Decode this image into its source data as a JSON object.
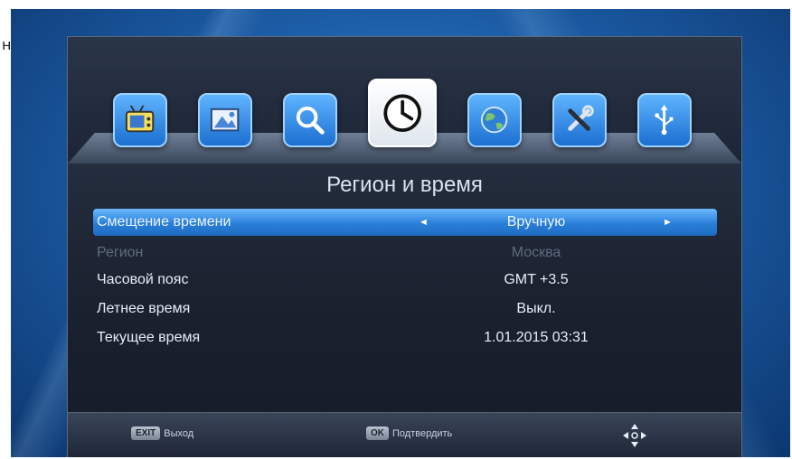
{
  "stray_text": "н",
  "menu": {
    "icons": [
      {
        "name": "tv-icon",
        "active": false
      },
      {
        "name": "picture-icon",
        "active": false
      },
      {
        "name": "search-icon",
        "active": false
      },
      {
        "name": "clock-icon",
        "active": true
      },
      {
        "name": "globe-icon",
        "active": false
      },
      {
        "name": "tools-icon",
        "active": false
      },
      {
        "name": "usb-icon",
        "active": false
      }
    ]
  },
  "page": {
    "title": "Регион и время"
  },
  "settings": {
    "rows": [
      {
        "label": "Смещение времени",
        "value": "Вручную",
        "selected": true,
        "dim": false
      },
      {
        "label": "Регион",
        "value": "Москва",
        "selected": false,
        "dim": true
      },
      {
        "label": "Часовой пояс",
        "value": "GMT +3.5",
        "selected": false,
        "dim": false
      },
      {
        "label": "Летнее время",
        "value": "Выкл.",
        "selected": false,
        "dim": false
      },
      {
        "label": "Текущее время",
        "value": "1.01.2015 03:31",
        "selected": false,
        "dim": false
      }
    ]
  },
  "footer": {
    "exit_key": "EXIT",
    "exit_label": "Выход",
    "ok_key": "OK",
    "ok_label": "Подтвердить",
    "nav_icon": "navigate-icon"
  },
  "colors": {
    "accent": "#2a7fd8",
    "panel": "#1b2230",
    "background": "#1d5ea8"
  }
}
